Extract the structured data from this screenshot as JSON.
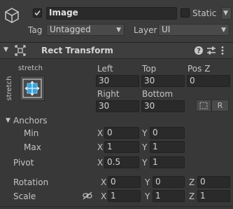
{
  "header": {
    "name": "Image",
    "static_label": "Static",
    "tag_label": "Tag",
    "tag_value": "Untagged",
    "layer_label": "Layer",
    "layer_value": "UI"
  },
  "component": {
    "title": "Rect Transform",
    "help_icon": "question-icon",
    "preset_icon": "sliders-icon",
    "menu_icon": "kebab-menu-icon"
  },
  "anchor_preset": {
    "horizontal": "stretch",
    "vertical": "stretch"
  },
  "position": {
    "left_label": "Left",
    "top_label": "Top",
    "posz_label": "Pos Z",
    "left": "30",
    "top": "30",
    "posz": "0",
    "right_label": "Right",
    "bottom_label": "Bottom",
    "right": "30",
    "bottom": "30",
    "raw_button": "R"
  },
  "anchors": {
    "label": "Anchors",
    "min_label": "Min",
    "min_x": "0",
    "min_y": "0",
    "max_label": "Max",
    "max_x": "1",
    "max_y": "1"
  },
  "pivot": {
    "label": "Pivot",
    "x": "0.5",
    "y": "1"
  },
  "rotation": {
    "label": "Rotation",
    "x": "0",
    "y": "0",
    "z": "0"
  },
  "scale": {
    "label": "Scale",
    "x": "1",
    "y": "1",
    "z": "1"
  },
  "axes": {
    "x": "X",
    "y": "Y",
    "z": "Z"
  },
  "colors": {
    "background": "#383838",
    "field_bg": "#2a2a2a",
    "anchor_accent": "#3aa0d8"
  }
}
